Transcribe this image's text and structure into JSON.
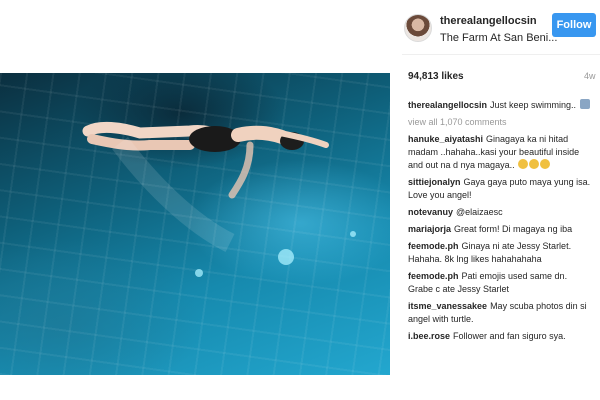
{
  "post": {
    "username": "therealangellocsin",
    "location": "The Farm At San Beni...",
    "follow_label": "Follow",
    "likes": "94,813 likes",
    "age": "4w"
  },
  "caption": {
    "user": "therealangellocsin",
    "text": "Just keep swimming.."
  },
  "view_all": "view all 1,070 comments",
  "comments": [
    {
      "user": "hanuke_aiyatashi",
      "text": "Ginagaya ka ni hitad madam ..hahaha..kasi your beautiful inside and out na d nya magaya.."
    },
    {
      "user": "sittiejonalyn",
      "text": "Gaya gaya puto maya yung isa. Love you angel!"
    },
    {
      "user": "notevanuy",
      "text": "@elaizaesc"
    },
    {
      "user": "mariajorja",
      "text": "Great form! Di magaya ng iba"
    },
    {
      "user": "feemode.ph",
      "text": "Ginaya ni ate Jessy Starlet. Hahaha. 8k lng likes hahahahaha"
    },
    {
      "user": "feemode.ph",
      "text": "Pati emojis used same dn. Grabe c ate Jessy Starlet"
    },
    {
      "user": "itsme_vanessakee",
      "text": "May scuba photos din si angel with turtle."
    },
    {
      "user": "i.bee.rose",
      "text": "Follower and fan siguro sya."
    }
  ],
  "icons": {
    "avatar": "profile-avatar",
    "emoji_face": "smiling-face-emoji",
    "emoji_house": "house-emoji"
  },
  "colors": {
    "follow_button": "#3897f0",
    "muted_text": "#999999",
    "pool_water": "#1689ad"
  }
}
